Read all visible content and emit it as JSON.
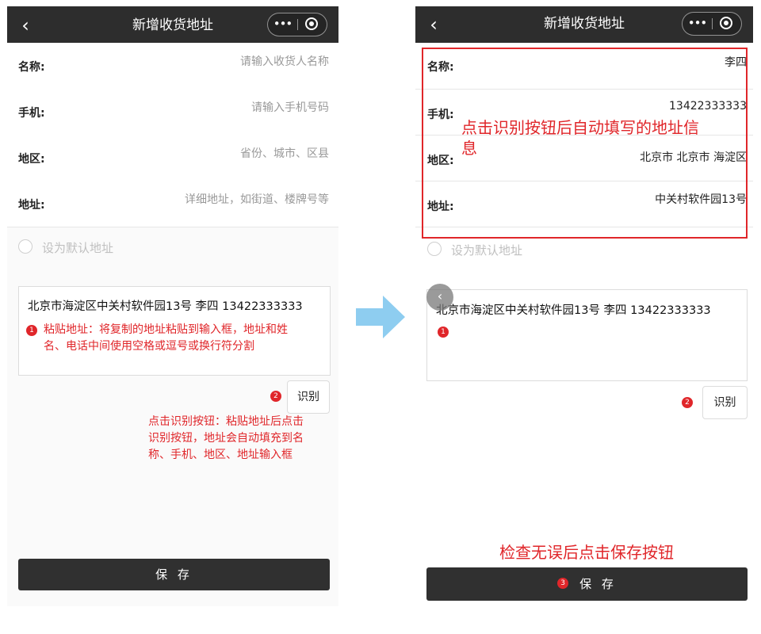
{
  "left": {
    "nav": {
      "back": "‹",
      "title": "新增收货地址",
      "more": "•••"
    },
    "rows": [
      {
        "label": "名称:",
        "placeholder": "请输入收货人名称"
      },
      {
        "label": "手机:",
        "placeholder": "请输入手机号码"
      },
      {
        "label": "地区:",
        "placeholder": "省份、城市、区县"
      },
      {
        "label": "地址:",
        "placeholder": "详细地址，如街道、楼牌号等"
      }
    ],
    "default_label": "设为默认地址",
    "paste_text": "北京市海淀区中关村软件园13号 李四 13422333333",
    "note1_badge": "1",
    "note1_line1": "粘贴地址：将复制的地址粘贴到输入框，地址和姓",
    "note1_line2": "名、电话中间使用空格或逗号或换行符分割",
    "note2_badge": "2",
    "recognize_label": "识别",
    "note2_line1": "点击识别按钮：粘贴地址后点击",
    "note2_line2": "识别按钮，地址会自动填充到名",
    "note2_line3": "称、手机、地区、地址输入框",
    "save_label": "保 存"
  },
  "right": {
    "nav": {
      "back": "‹",
      "title": "新增收货地址",
      "more": "•••"
    },
    "rows": [
      {
        "label": "名称:",
        "value": "李四"
      },
      {
        "label": "手机:",
        "value": "13422333333"
      },
      {
        "label": "地区:",
        "value": "北京市 北京市 海淀区"
      },
      {
        "label": "地址:",
        "value": "中关村软件园13号"
      }
    ],
    "autofill_note_line1": "点击识别按钮后自动填写的地址信",
    "autofill_note_line2": "息",
    "default_label": "设为默认地址",
    "paste_text": "北京市海淀区中关村软件园13号 李四 13422333333",
    "scroll_glyph": "‹",
    "badge1": "1",
    "badge2": "2",
    "recognize_label": "识别",
    "check_note": "检查无误后点击保存按钮",
    "badge3": "3",
    "save_label": "保 存"
  },
  "colors": {
    "accent_red": "#e0262a",
    "nav_bg": "#2d2d2d",
    "save_bg": "#303030",
    "arrow": "#8ecdf0"
  },
  "icons": {
    "back": "chevron-left-icon",
    "more": "more-dots-icon",
    "close": "target-circle-icon",
    "arrow": "right-arrow-icon"
  }
}
